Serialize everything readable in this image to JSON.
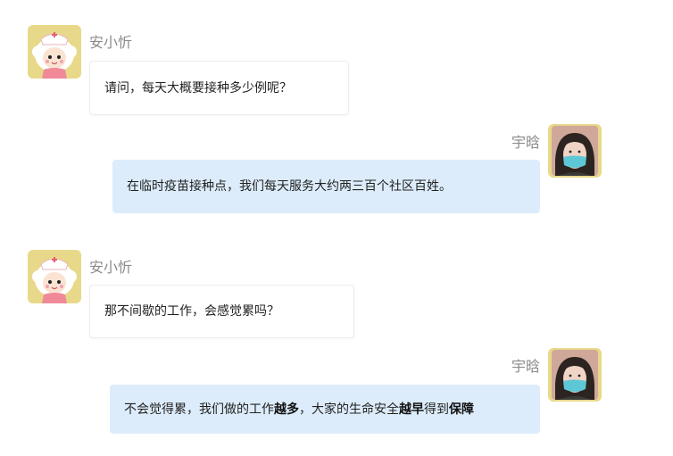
{
  "colors": {
    "left_bubble_bg": "#ffffff",
    "right_bubble_bg": "#dcecfb",
    "name_text": "#8a8a8a",
    "avatar_bg": "#e8d98a"
  },
  "messages": [
    {
      "side": "left",
      "sender": "安小忻",
      "avatar_icon": "nurse-cartoon-avatar",
      "text": "请问，每天大概要接种多少例呢？"
    },
    {
      "side": "right",
      "sender": "宇晗",
      "avatar_icon": "masked-person-photo-avatar",
      "text": "在临时疫苗接种点，我们每天服务大约两三百个社区百姓。"
    },
    {
      "side": "left",
      "sender": "安小忻",
      "avatar_icon": "nurse-cartoon-avatar",
      "text": "那不间歇的工作，会感觉累吗？"
    },
    {
      "side": "right",
      "sender": "宇晗",
      "avatar_icon": "masked-person-photo-avatar",
      "text_parts": [
        {
          "text": "不会觉得累，我们做的工作",
          "bold": false
        },
        {
          "text": "越多",
          "bold": true
        },
        {
          "text": "，大家的生命安全",
          "bold": false
        },
        {
          "text": "越早",
          "bold": true
        },
        {
          "text": "得到",
          "bold": false
        },
        {
          "text": "保障",
          "bold": true
        }
      ]
    }
  ]
}
